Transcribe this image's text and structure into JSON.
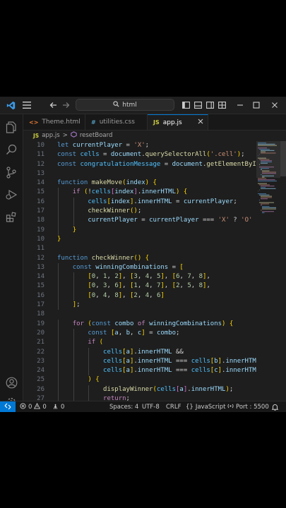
{
  "titlebar": {
    "search_text": "html"
  },
  "tabs": [
    {
      "label": "Theme.html",
      "active": false
    },
    {
      "label": "utilities.css",
      "active": false
    },
    {
      "label": "app.js",
      "active": true
    }
  ],
  "breadcrumb": {
    "file_badge": "JS",
    "file": "app.js",
    "separator": ">",
    "symbol": "resetBoard"
  },
  "tab_badges": {
    "html": "<>",
    "css": "#",
    "js": "JS"
  },
  "code": {
    "lines": [
      {
        "n": "10",
        "t": "let currentPlayer = 'X';"
      },
      {
        "n": "11",
        "t": "const cells = document.querySelectorAll('.cell');"
      },
      {
        "n": "12",
        "t": "const congratulationMessage = document.getElementById("
      },
      {
        "n": "13",
        "t": ""
      },
      {
        "n": "14",
        "t": "function makeMove(index) {"
      },
      {
        "n": "15",
        "t": "    if (!cells[index].innerHTML) {"
      },
      {
        "n": "16",
        "t": "        cells[index].innerHTML = currentPlayer;"
      },
      {
        "n": "17",
        "t": "        checkWinner();"
      },
      {
        "n": "18",
        "t": "        currentPlayer = currentPlayer === 'X' ? 'O'"
      },
      {
        "n": "19",
        "t": "    }"
      },
      {
        "n": "10",
        "t": "}"
      },
      {
        "n": "11",
        "t": ""
      },
      {
        "n": "12",
        "t": "function checkWinner() {"
      },
      {
        "n": "13",
        "t": "    const winningCombinations = ["
      },
      {
        "n": "14",
        "t": "        [0, 1, 2], [3, 4, 5], [6, 7, 8],"
      },
      {
        "n": "15",
        "t": "        [0, 3, 6], [1, 4, 7], [2, 5, 8],"
      },
      {
        "n": "16",
        "t": "        [0, 4, 8], [2, 4, 6]"
      },
      {
        "n": "17",
        "t": "    ];"
      },
      {
        "n": "18",
        "t": ""
      },
      {
        "n": "19",
        "t": "    for (const combo of winningCombinations) {"
      },
      {
        "n": "20",
        "t": "        const [a, b, c] = combo;"
      },
      {
        "n": "21",
        "t": "        if ("
      },
      {
        "n": "22",
        "t": "            cells[a].innerHTML &&"
      },
      {
        "n": "23",
        "t": "            cells[a].innerHTML === cells[b].innerHTM"
      },
      {
        "n": "24",
        "t": "            cells[a].innerHTML === cells[c].innerHTM"
      },
      {
        "n": "25",
        "t": "        ) {"
      },
      {
        "n": "26",
        "t": "            displayWinner(cells[a].innerHTML);"
      },
      {
        "n": "27",
        "t": "            return;"
      }
    ]
  },
  "statusbar": {
    "remote_icon": "remote-icon",
    "errors": "0",
    "warnings": "0",
    "ports": "0",
    "spaces": "Spaces: 4",
    "encoding": "UTF-8",
    "eol": "CRLF",
    "language_glyph": "{}",
    "language": "JavaScript",
    "port": "Port : 5500"
  },
  "colors": {
    "accent": "#0078d4",
    "background": "#1e1e1e",
    "keyword": "#569cd6",
    "function": "#dcdcaa",
    "string": "#ce9178",
    "number": "#b5cea8",
    "variable": "#9cdcfe"
  }
}
